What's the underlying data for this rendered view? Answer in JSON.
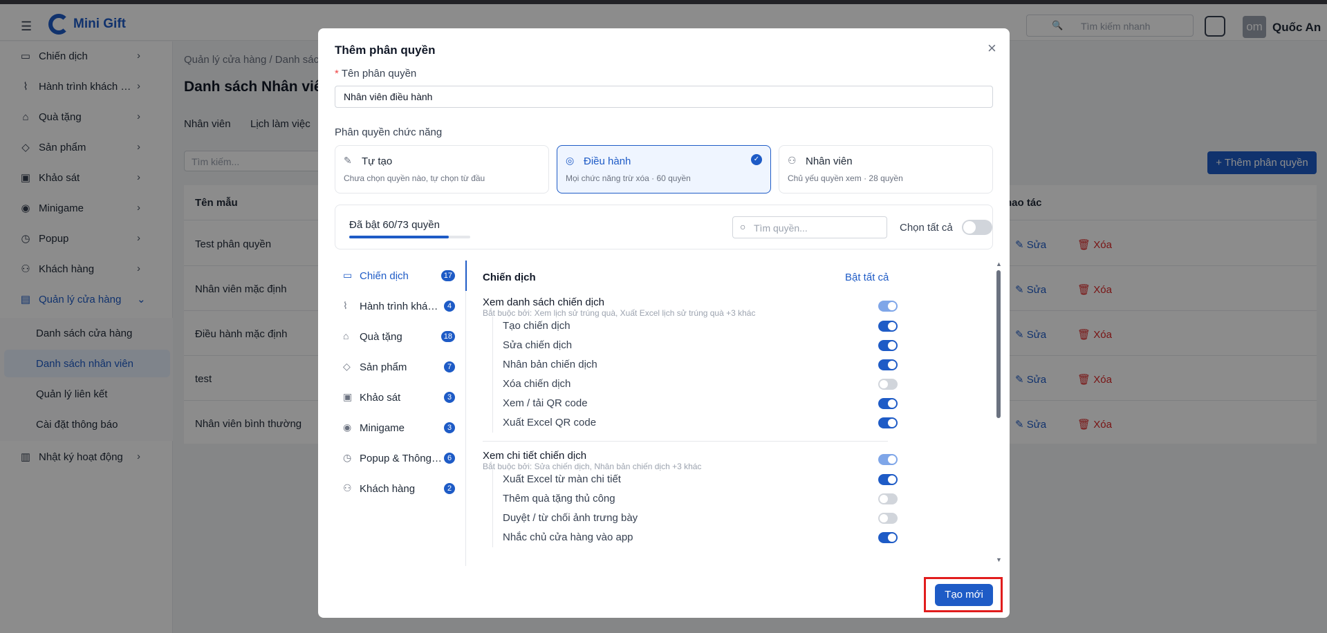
{
  "header": {
    "brand": "Mini Gift",
    "search_placeholder": "Tìm kiếm nhanh",
    "avatar_initials": "om",
    "user_name": "Quốc An"
  },
  "sidebar": {
    "items": [
      {
        "label": "Chiến dịch",
        "icon": "megaphone-icon"
      },
      {
        "label": "Hành trình khách hà...",
        "icon": "route-icon"
      },
      {
        "label": "Quà tặng",
        "icon": "gift-icon"
      },
      {
        "label": "Sản phẩm",
        "icon": "box-icon"
      },
      {
        "label": "Khảo sát",
        "icon": "survey-icon"
      },
      {
        "label": "Minigame",
        "icon": "gamepad-icon"
      },
      {
        "label": "Popup",
        "icon": "popup-icon"
      },
      {
        "label": "Khách hàng",
        "icon": "users-icon"
      },
      {
        "label": "Quản lý cửa hàng",
        "icon": "store-icon"
      },
      {
        "label": "Nhật ký hoạt động",
        "icon": "log-icon"
      }
    ],
    "sub_items": [
      "Danh sách cửa hàng",
      "Danh sách nhân viên",
      "Quản lý liên kết",
      "Cài đặt thông báo"
    ]
  },
  "page": {
    "breadcrumb": "Quản lý cửa hàng  /  Danh sác",
    "title": "Danh sách Nhân viên",
    "tabs": [
      "Nhân viên",
      "Lịch làm việc"
    ],
    "search_placeholder": "Tìm kiếm...",
    "add_button": "+ Thêm phân quyền",
    "col_name": "Tên mẫu",
    "col_action": "hao tác",
    "rows": [
      "Test phân quyền",
      "Nhân viên mặc định",
      "Điều hành mặc định",
      "test",
      "Nhân viên bình thường"
    ],
    "edit_label": "Sửa",
    "delete_label": "Xóa"
  },
  "modal": {
    "title": "Thêm phân quyền",
    "name_label": "Tên phân quyền",
    "name_value": "Nhân viên điều hành",
    "section_label": "Phân quyền chức năng",
    "roles": [
      {
        "name": "Tự tạo",
        "desc": "Chưa chọn quyền nào, tự chọn từ đầu"
      },
      {
        "name": "Điều hành",
        "desc": "Mọi chức năng trừ xóa · 60 quyền"
      },
      {
        "name": "Nhân viên",
        "desc": "Chủ yếu quyền xem · 28 quyền"
      }
    ],
    "enabled_summary": "Đã bật 60/73 quyền",
    "enabled_fraction": 0.82,
    "perm_search_placeholder": "Tìm quyền...",
    "select_all_label": "Chọn tất cả",
    "categories": [
      {
        "label": "Chiến dịch",
        "count": "17"
      },
      {
        "label": "Hành trình khách...",
        "count": "4"
      },
      {
        "label": "Quà tặng",
        "count": "18"
      },
      {
        "label": "Sản phẩm",
        "count": "7"
      },
      {
        "label": "Khảo sát",
        "count": "3"
      },
      {
        "label": "Minigame",
        "count": "3"
      },
      {
        "label": "Popup & Thông ...",
        "count": "6"
      },
      {
        "label": "Khách hàng",
        "count": "2"
      }
    ],
    "detail_title": "Chiến dịch",
    "enable_all_label": "Bật tất cả",
    "groups": [
      {
        "title": "Xem danh sách chiến dịch",
        "subtitle": "Bắt buộc bởi: Xem lịch sử trúng quà, Xuất Excel lịch sử trúng quà +3 khác",
        "perms": [
          {
            "label": "Tạo chiến dịch",
            "on": true
          },
          {
            "label": "Sửa chiến dịch",
            "on": true
          },
          {
            "label": "Nhân bản chiến dịch",
            "on": true
          },
          {
            "label": "Xóa chiến dịch",
            "on": false
          },
          {
            "label": "Xem / tải QR code",
            "on": true
          },
          {
            "label": "Xuất Excel QR code",
            "on": true
          }
        ]
      },
      {
        "title": "Xem chi tiết chiến dịch",
        "subtitle": "Bắt buộc bởi: Sửa chiến dịch, Nhân bản chiến dịch +3 khác",
        "perms": [
          {
            "label": "Xuất Excel từ màn chi tiết",
            "on": true
          },
          {
            "label": "Thêm quà tặng thủ công",
            "on": false
          },
          {
            "label": "Duyệt / từ chối ảnh trưng bày",
            "on": false
          },
          {
            "label": "Nhắc chủ cửa hàng vào app",
            "on": true
          }
        ]
      }
    ],
    "create_button": "Tạo mới"
  },
  "colors": {
    "accent": "#1e5bc6",
    "danger": "#dc2626",
    "highlight": "#e11d1d"
  }
}
